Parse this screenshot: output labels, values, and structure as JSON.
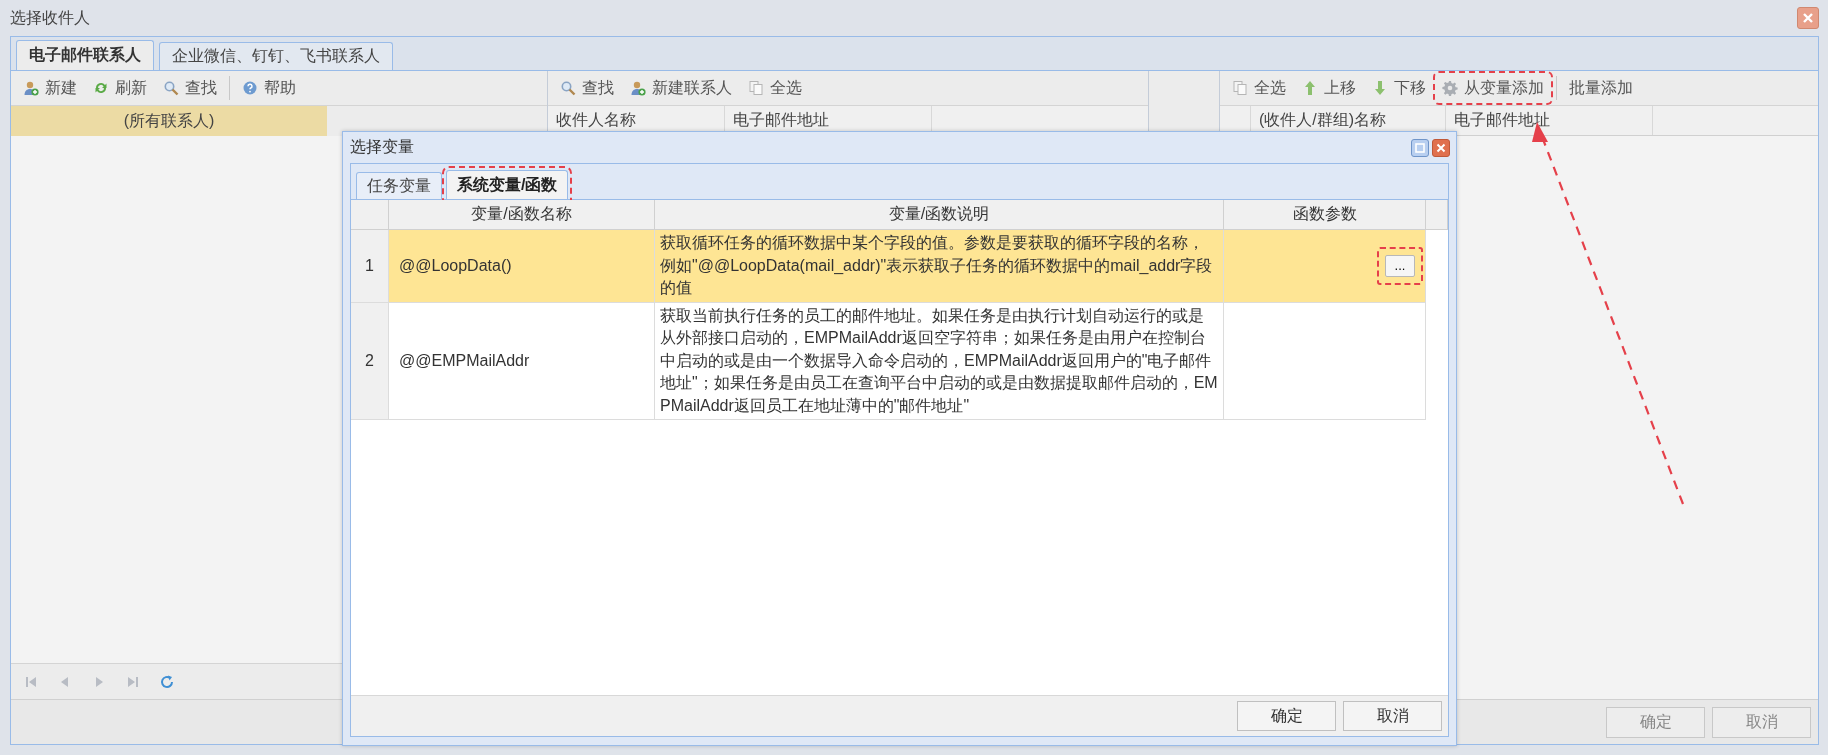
{
  "window": {
    "title": "选择收件人"
  },
  "tabs": [
    {
      "label": "电子邮件联系人",
      "selected": true
    },
    {
      "label": "企业微信、钉钉、飞书联系人",
      "selected": false
    }
  ],
  "left_toolbar": [
    {
      "label": "新建",
      "kind": "add-user"
    },
    {
      "label": "刷新",
      "kind": "refresh"
    },
    {
      "label": "查找",
      "kind": "search"
    },
    {
      "label": "帮助",
      "kind": "help"
    }
  ],
  "contact_tree": [
    {
      "label": "(所有联系人)",
      "selected": true
    }
  ],
  "pager": [
    {
      "kind": "first",
      "disabled": true
    },
    {
      "kind": "prev",
      "disabled": true
    },
    {
      "kind": "next",
      "disabled": true
    },
    {
      "kind": "last",
      "disabled": true
    },
    {
      "kind": "refresh",
      "disabled": false
    }
  ],
  "middle_toolbar": [
    {
      "label": "查找",
      "kind": "search"
    },
    {
      "label": "新建联系人",
      "kind": "add-user"
    },
    {
      "label": "全选",
      "kind": "copy"
    }
  ],
  "middle_table": {
    "columns": [
      "收件人名称",
      "电子邮件地址"
    ]
  },
  "right_toolbar": [
    {
      "label": "全选",
      "kind": "copy",
      "highlighted": false
    },
    {
      "label": "上移",
      "kind": "up",
      "highlighted": false
    },
    {
      "label": "下移",
      "kind": "down",
      "highlighted": false
    },
    {
      "label": "从变量添加",
      "kind": "gear",
      "highlighted": true
    },
    {
      "label": "批量添加",
      "kind": "text",
      "highlighted": false
    }
  ],
  "right_table": {
    "columns": [
      "(收件人/群组)名称",
      "电子邮件地址"
    ]
  },
  "buttons": [
    "确定",
    "取消"
  ],
  "dialog": {
    "title": "选择变量",
    "tabs": [
      {
        "label": "任务变量",
        "selected": false,
        "highlighted": false
      },
      {
        "label": "系统变量/函数",
        "selected": true,
        "highlighted": true
      }
    ],
    "table": {
      "columns": [
        "变量/函数名称",
        "变量/函数说明",
        "函数参数"
      ],
      "rows": [
        {
          "index": "1",
          "name": "@@LoopData()",
          "description": "获取循环任务的循环数据中某个字段的值。参数是要获取的循环字段的名称，例如\"@@LoopData(mail_addr)\"表示获取子任务的循环数据中的mail_addr字段的值",
          "param_button": {
            "label": "...",
            "highlighted": true
          },
          "selected": true
        },
        {
          "index": "2",
          "name": "@@EMPMailAddr",
          "description": "获取当前执行任务的员工的邮件地址。如果任务是由执行计划自动运行的或是从外部接口启动的，EMPMailAddr返回空字符串；如果任务是由用户在控制台中启动的或是由一个数据导入命令启动的，EMPMailAddr返回用户的\"电子邮件地址\"；如果任务是由员工在查询平台中启动的或是由数据提取邮件启动的，EMPMailAddr返回员工在地址薄中的\"邮件地址\"",
          "selected": false
        }
      ]
    },
    "buttons": [
      "确定",
      "取消"
    ]
  }
}
